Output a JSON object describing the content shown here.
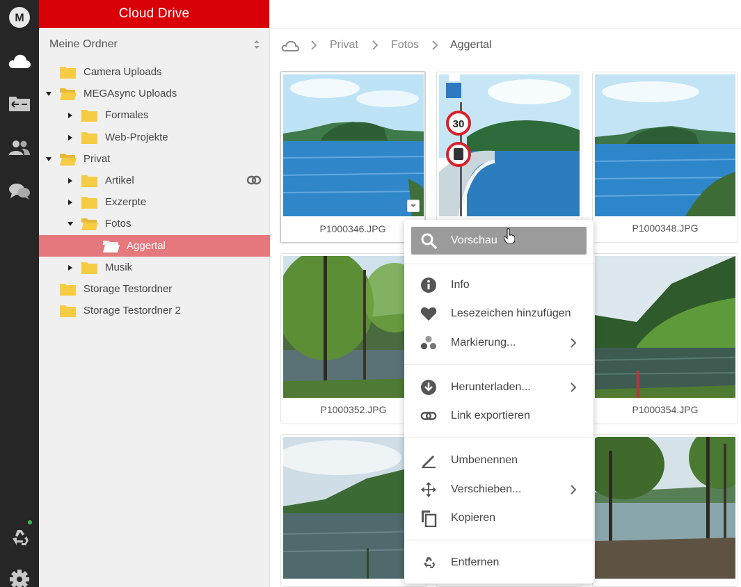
{
  "app": {
    "brand_title": "Cloud Drive",
    "logo_letter": "M"
  },
  "colors": {
    "brand_red": "#d90007",
    "selected_row": "#e4787c",
    "rail_bg": "#262626",
    "folder_yellow": "#f6cc45",
    "sync_dot": "#3fbf4a"
  },
  "rail": {
    "items": [
      {
        "name": "mega-logo-icon"
      },
      {
        "name": "cloud-drive-icon"
      },
      {
        "name": "inbox-icon"
      },
      {
        "name": "contacts-icon"
      },
      {
        "name": "chat-icon"
      },
      {
        "name": "rubbish-bin-icon"
      },
      {
        "name": "settings-icon"
      }
    ]
  },
  "tree": {
    "header": "Meine Ordner",
    "items": [
      {
        "label": "Camera Uploads",
        "level": 0,
        "arrow": "none"
      },
      {
        "label": "MEGAsync Uploads",
        "level": 0,
        "arrow": "down"
      },
      {
        "label": "Formales",
        "level": 1,
        "arrow": "right"
      },
      {
        "label": "Web-Projekte",
        "level": 1,
        "arrow": "right"
      },
      {
        "label": "Privat",
        "level": 0,
        "arrow": "down"
      },
      {
        "label": "Artikel",
        "level": 1,
        "arrow": "right",
        "shared_link": true
      },
      {
        "label": "Exzerpte",
        "level": 1,
        "arrow": "right"
      },
      {
        "label": "Fotos",
        "level": 1,
        "arrow": "down"
      },
      {
        "label": "Aggertal",
        "level": 2,
        "arrow": "none",
        "selected": true
      },
      {
        "label": "Musik",
        "level": 1,
        "arrow": "right"
      },
      {
        "label": "Storage Testordner",
        "level": 0,
        "arrow": "none"
      },
      {
        "label": "Storage Testordner 2",
        "level": 0,
        "arrow": "none"
      }
    ]
  },
  "breadcrumb": {
    "items": [
      "Privat",
      "Fotos",
      "Aggertal"
    ]
  },
  "files": [
    {
      "name": "P1000346.JPG"
    },
    {
      "name": ""
    },
    {
      "name": "P1000348.JPG"
    },
    {
      "name": "P1000352.JPG"
    },
    {
      "name": ""
    },
    {
      "name": "P1000354.JPG"
    },
    {
      "name": ""
    },
    {
      "name": ""
    },
    {
      "name": ""
    }
  ],
  "context_menu": {
    "items": [
      {
        "label": "Vorschau",
        "icon": "search-icon",
        "highlight": true
      },
      {
        "label": "Info",
        "icon": "info-icon"
      },
      {
        "label": "Lesezeichen hinzufügen",
        "icon": "heart-icon"
      },
      {
        "label": "Markierung...",
        "icon": "label-dots-icon",
        "submenu": true
      },
      {
        "label": "Herunterladen...",
        "icon": "download-icon",
        "submenu": true
      },
      {
        "label": "Link exportieren",
        "icon": "link-icon"
      },
      {
        "label": "Umbenennen",
        "icon": "pencil-icon"
      },
      {
        "label": "Verschieben...",
        "icon": "move-icon",
        "submenu": true
      },
      {
        "label": "Kopieren",
        "icon": "copy-icon"
      },
      {
        "label": "Entfernen",
        "icon": "remove-icon"
      }
    ]
  }
}
